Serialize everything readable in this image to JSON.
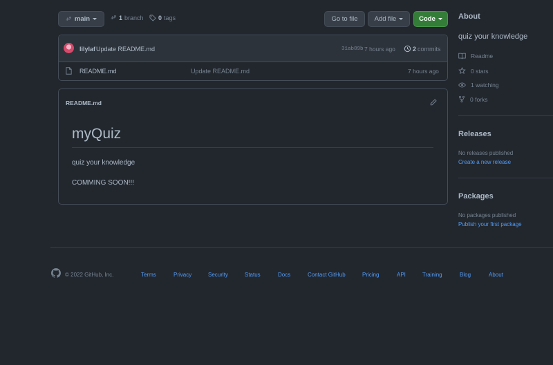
{
  "branch": {
    "name": "main",
    "branch_count": "1",
    "branch_label": "branch",
    "tag_count": "0",
    "tag_label": "tags"
  },
  "toolbar": {
    "go_to_file": "Go to file",
    "add_file": "Add file",
    "code": "Code"
  },
  "commit": {
    "author": "lilylaf",
    "message": "Update README.md",
    "hash": "31ab89b",
    "time": "7 hours ago",
    "count": "2",
    "count_label": "commits"
  },
  "files": [
    {
      "name": "README.md",
      "message": "Update README.md",
      "time": "7 hours ago"
    }
  ],
  "readme": {
    "filename": "README.md",
    "title": "myQuiz",
    "paragraph1": "quiz your knowledge",
    "paragraph2": "COMMING SOON!!!"
  },
  "about": {
    "heading": "About",
    "description": "quiz your knowledge",
    "readme": "Readme",
    "stars": "0 stars",
    "watching": "1 watching",
    "forks": "0 forks"
  },
  "releases": {
    "heading": "Releases",
    "empty": "No releases published",
    "create": "Create a new release"
  },
  "packages": {
    "heading": "Packages",
    "empty": "No packages published",
    "publish": "Publish your first package"
  },
  "footer": {
    "copyright": "© 2022 GitHub, Inc.",
    "links": [
      "Terms",
      "Privacy",
      "Security",
      "Status",
      "Docs",
      "Contact GitHub",
      "Pricing",
      "API",
      "Training",
      "Blog",
      "About"
    ]
  },
  "colors": {
    "background": "#22272e",
    "border": "#444c56",
    "link": "#539bf5",
    "green_button": "#347d39",
    "text": "#adbac7",
    "muted": "#768390"
  }
}
